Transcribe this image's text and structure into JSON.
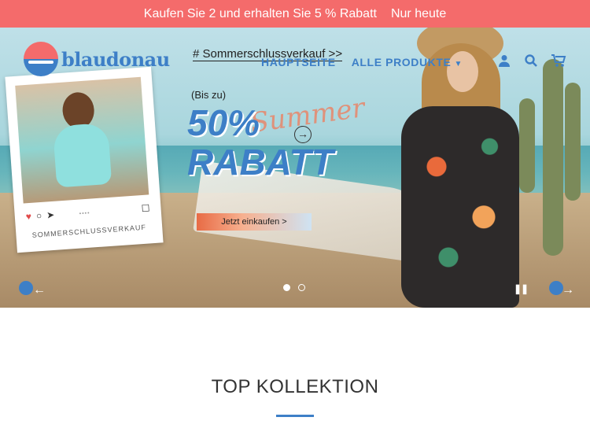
{
  "announcement": {
    "text": "Kaufen Sie 2 und erhalten Sie 5 % Rabatt",
    "highlight": "Nur heute"
  },
  "brand": {
    "logo_text": "blaudonau",
    "accent_color": "#3d7fc7",
    "promo_color": "#f46b6b"
  },
  "header": {
    "promo_link": "# Sommerschlussverkauf >>",
    "nav": [
      {
        "label": "HAUPTSEITE"
      },
      {
        "label": "ALLE PRODUKTE"
      }
    ],
    "icons": [
      "user-icon",
      "search-icon",
      "cart-icon"
    ]
  },
  "hero": {
    "prefix": "(Bis zu)",
    "script_text": "Summer",
    "headline_1": "50%",
    "headline_2": "RABATT",
    "cta": "Jetzt einkaufen >",
    "polaroid_caption": "SOMMERSCHLUSSVERKAUF",
    "slide_current": 1,
    "slide_count": 2
  },
  "section": {
    "title": "TOP KOLLEKTION"
  }
}
